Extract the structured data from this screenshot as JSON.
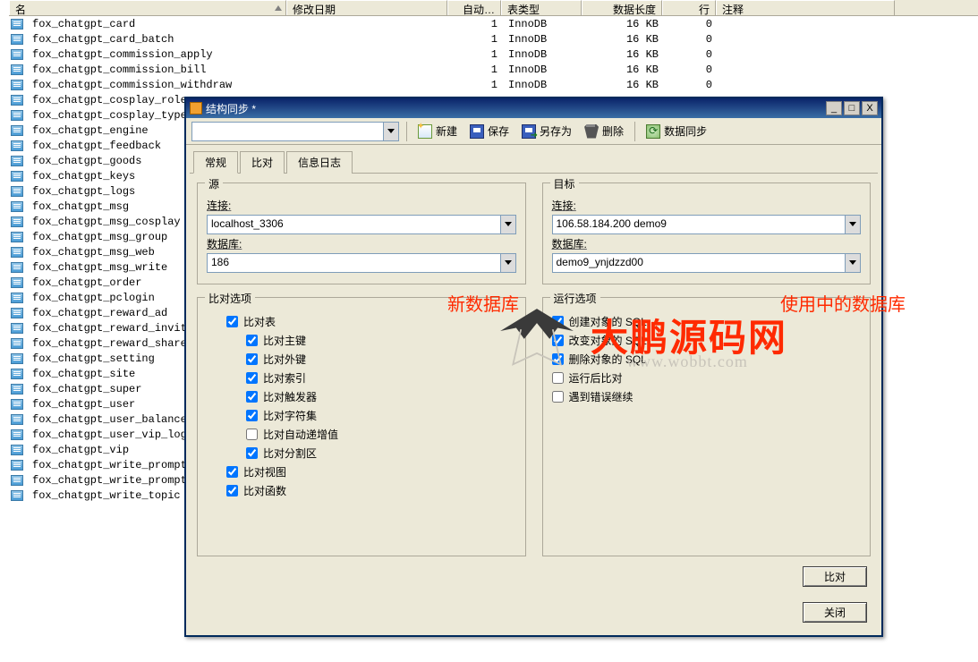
{
  "columns": {
    "name": "名",
    "date": "修改日期",
    "auto": "自动…",
    "ttype": "表类型",
    "length": "数据长度",
    "rows": "行",
    "note": "注释"
  },
  "rows": [
    {
      "name": "fox_chatgpt_card",
      "auto": "1",
      "type": "InnoDB",
      "len": "16 KB",
      "rows": "0"
    },
    {
      "name": "fox_chatgpt_card_batch",
      "auto": "1",
      "type": "InnoDB",
      "len": "16 KB",
      "rows": "0"
    },
    {
      "name": "fox_chatgpt_commission_apply",
      "auto": "1",
      "type": "InnoDB",
      "len": "16 KB",
      "rows": "0"
    },
    {
      "name": "fox_chatgpt_commission_bill",
      "auto": "1",
      "type": "InnoDB",
      "len": "16 KB",
      "rows": "0"
    },
    {
      "name": "fox_chatgpt_commission_withdraw",
      "auto": "1",
      "type": "InnoDB",
      "len": "16 KB",
      "rows": "0"
    },
    {
      "name": "fox_chatgpt_cosplay_role"
    },
    {
      "name": "fox_chatgpt_cosplay_type"
    },
    {
      "name": "fox_chatgpt_engine"
    },
    {
      "name": "fox_chatgpt_feedback"
    },
    {
      "name": "fox_chatgpt_goods"
    },
    {
      "name": "fox_chatgpt_keys"
    },
    {
      "name": "fox_chatgpt_logs"
    },
    {
      "name": "fox_chatgpt_msg"
    },
    {
      "name": "fox_chatgpt_msg_cosplay"
    },
    {
      "name": "fox_chatgpt_msg_group"
    },
    {
      "name": "fox_chatgpt_msg_web"
    },
    {
      "name": "fox_chatgpt_msg_write"
    },
    {
      "name": "fox_chatgpt_order"
    },
    {
      "name": "fox_chatgpt_pclogin"
    },
    {
      "name": "fox_chatgpt_reward_ad"
    },
    {
      "name": "fox_chatgpt_reward_invite"
    },
    {
      "name": "fox_chatgpt_reward_share"
    },
    {
      "name": "fox_chatgpt_setting"
    },
    {
      "name": "fox_chatgpt_site"
    },
    {
      "name": "fox_chatgpt_super"
    },
    {
      "name": "fox_chatgpt_user"
    },
    {
      "name": "fox_chatgpt_user_balance_logs"
    },
    {
      "name": "fox_chatgpt_user_vip_logs"
    },
    {
      "name": "fox_chatgpt_vip"
    },
    {
      "name": "fox_chatgpt_write_prompts"
    },
    {
      "name": "fox_chatgpt_write_prompts_vars"
    },
    {
      "name": "fox_chatgpt_write_topic"
    }
  ],
  "dialog": {
    "title": "结构同步 *",
    "toolbar": {
      "new": "新建",
      "save": "保存",
      "saveas": "另存为",
      "del": "删除",
      "sync": "数据同步"
    },
    "tabs": {
      "t1": "常规",
      "t2": "比对",
      "t3": "信息日志"
    },
    "src": {
      "legend": "源",
      "conn_lab": "连接:",
      "conn_val": "localhost_3306",
      "db_lab": "数据库:",
      "db_val": "186"
    },
    "dst": {
      "legend": "目标",
      "conn_lab": "连接:",
      "conn_val": "106.58.184.200 demo9",
      "db_lab": "数据库:",
      "db_val": "demo9_ynjdzzd00"
    },
    "cmp": {
      "legend": "比对选项",
      "tables": "比对表",
      "pk": "比对主键",
      "fk": "比对外键",
      "idx": "比对索引",
      "trg": "比对触发器",
      "charset": "比对字符集",
      "autoinc": "比对自动递增值",
      "part": "比对分割区",
      "views": "比对视图",
      "funcs": "比对函数"
    },
    "run": {
      "legend": "运行选项",
      "create": "创建对象的 SQL",
      "alter": "改变对象的 SQL",
      "drop": "删除对象的 SQL",
      "after": "运行后比对",
      "cont": "遇到错误继续"
    },
    "buttons": {
      "compare": "比对",
      "close": "关闭"
    }
  },
  "anno": {
    "newdb": "新数据库",
    "usedb": "使用中的数据库",
    "brand": "大鹏源码网",
    "url": "www.wobbt.com"
  }
}
